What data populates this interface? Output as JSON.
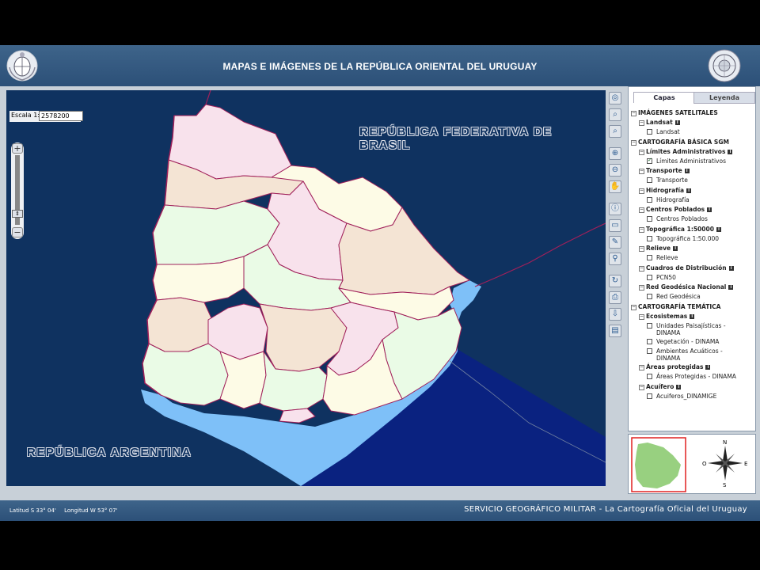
{
  "header": {
    "title": "MAPAS E IMÁGENES DE LA REPÚBLICA ORIENTAL DEL URUGUAY"
  },
  "map": {
    "scale_label": "Escala 1:",
    "scale_value": "2578200",
    "brasil_label": "REPÚBLICA FEDERATIVA DE BRASIL",
    "argentina_label": "REPÚBLICA ARGENTINA",
    "colors": {
      "background": "#0f3260",
      "ocean": "#0a2280",
      "rio_de_la_plata": "#7ec0f8",
      "border": "#a0205a"
    }
  },
  "toolbar": {
    "tools": [
      "globe-icon",
      "zoom-full-icon",
      "zoom-previous-icon",
      "zoom-in-icon",
      "zoom-out-icon",
      "pan-hand-icon",
      "info-icon",
      "tooltip-icon",
      "measure-icon",
      "point-icon",
      "refresh-icon",
      "print-icon",
      "download-icon",
      "book-icon"
    ]
  },
  "panel": {
    "tabs": [
      "Capas",
      "Leyenda"
    ],
    "active_tab": "Capas",
    "layers": [
      {
        "type": "group",
        "label": "IMÁGENES SATELITALES"
      },
      {
        "type": "sub",
        "label": "Landsat",
        "info": "i"
      },
      {
        "type": "leaf",
        "label": "Landsat",
        "checked": false
      },
      {
        "type": "group",
        "label": "CARTOGRAFÍA BÁSICA SGM"
      },
      {
        "type": "sub",
        "label": "Límites Administrativos",
        "info": "i"
      },
      {
        "type": "leaf",
        "label": "Límites Administrativos",
        "checked": true
      },
      {
        "type": "sub",
        "label": "Transporte",
        "info": "i"
      },
      {
        "type": "leaf",
        "label": "Transporte",
        "checked": false
      },
      {
        "type": "sub",
        "label": "Hidrografía",
        "info": "i"
      },
      {
        "type": "leaf",
        "label": "Hidrografía",
        "checked": false
      },
      {
        "type": "sub",
        "label": "Centros Poblados",
        "info": "i"
      },
      {
        "type": "leaf",
        "label": "Centros Poblados",
        "checked": false
      },
      {
        "type": "sub",
        "label": "Topográfica 1:50000",
        "info": "i"
      },
      {
        "type": "leaf",
        "label": "Topográfica 1:50.000",
        "checked": false
      },
      {
        "type": "sub",
        "label": "Relieve",
        "info": "i"
      },
      {
        "type": "leaf",
        "label": "Relieve",
        "checked": false
      },
      {
        "type": "sub",
        "label": "Cuadros de Distribución",
        "info": "i"
      },
      {
        "type": "leaf",
        "label": "PCN50",
        "checked": false
      },
      {
        "type": "sub",
        "label": "Red Geodésica Nacional",
        "info": "i"
      },
      {
        "type": "leaf",
        "label": "Red Geodésica",
        "checked": false
      },
      {
        "type": "group",
        "label": "CARTOGRAFÍA TEMÁTICA"
      },
      {
        "type": "sub",
        "label": "Ecosistemas",
        "info": "i"
      },
      {
        "type": "leaf2",
        "label": "Unidades Paisajísticas -",
        "label2": "DINAMA",
        "checked": false
      },
      {
        "type": "leaf",
        "label": "Vegetación - DINAMA",
        "checked": false
      },
      {
        "type": "leaf2",
        "label": "Ambientes Acuáticos -",
        "label2": "DINAMA",
        "checked": false
      },
      {
        "type": "sub",
        "label": "Áreas protegidas",
        "info": "i"
      },
      {
        "type": "leaf",
        "label": "Áreas Protegidas - DINAMA",
        "checked": false
      },
      {
        "type": "sub",
        "label": "Acuífero",
        "info": "i"
      },
      {
        "type": "leaf",
        "label": "Acuiferos_DINAMIGE",
        "checked": false
      }
    ]
  },
  "overview": {
    "compass": {
      "n": "N",
      "s": "S",
      "e": "E",
      "o": "O"
    },
    "colors": {
      "land": "#98d080",
      "frame": "#e02020"
    }
  },
  "footer": {
    "latitude": "Latitud S 33° 04'",
    "longitude": "Longitud W 53° 07'",
    "organization": "SERVICIO GEOGRÁFICO MILITAR - La Cartografía Oficial del Uruguay"
  }
}
